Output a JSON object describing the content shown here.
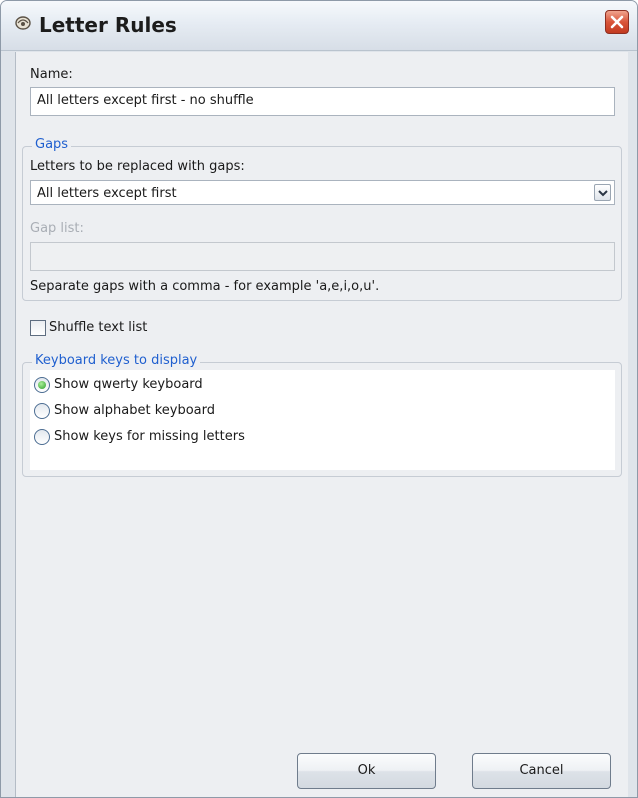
{
  "window": {
    "title": "Letter Rules",
    "icon": "letter-rules-app-icon",
    "close_icon": "close-x-icon",
    "close_color": "#d9553a"
  },
  "form": {
    "name_label": "Name:",
    "name_value": "All letters except first - no shuffle",
    "gaps": {
      "legend": "Gaps",
      "replace_label": "Letters to be replaced with gaps:",
      "replace_selected": "All letters except first",
      "gap_list_label": "Gap list:",
      "gap_list_value": "",
      "hint": "Separate gaps with a comma - for example 'a,e,i,o,u'."
    },
    "shuffle": {
      "label": "Shuffle text list",
      "checked": false
    },
    "keyboard": {
      "legend": "Keyboard keys to display",
      "options": [
        {
          "label": "Show qwerty keyboard",
          "selected": true
        },
        {
          "label": "Show alphabet keyboard",
          "selected": false
        },
        {
          "label": "Show keys for missing letters",
          "selected": false
        }
      ]
    }
  },
  "buttons": {
    "ok": "Ok",
    "cancel": "Cancel"
  },
  "colors": {
    "group_legend": "#1f5fcf",
    "radio_selected": "#2f9e2a"
  }
}
